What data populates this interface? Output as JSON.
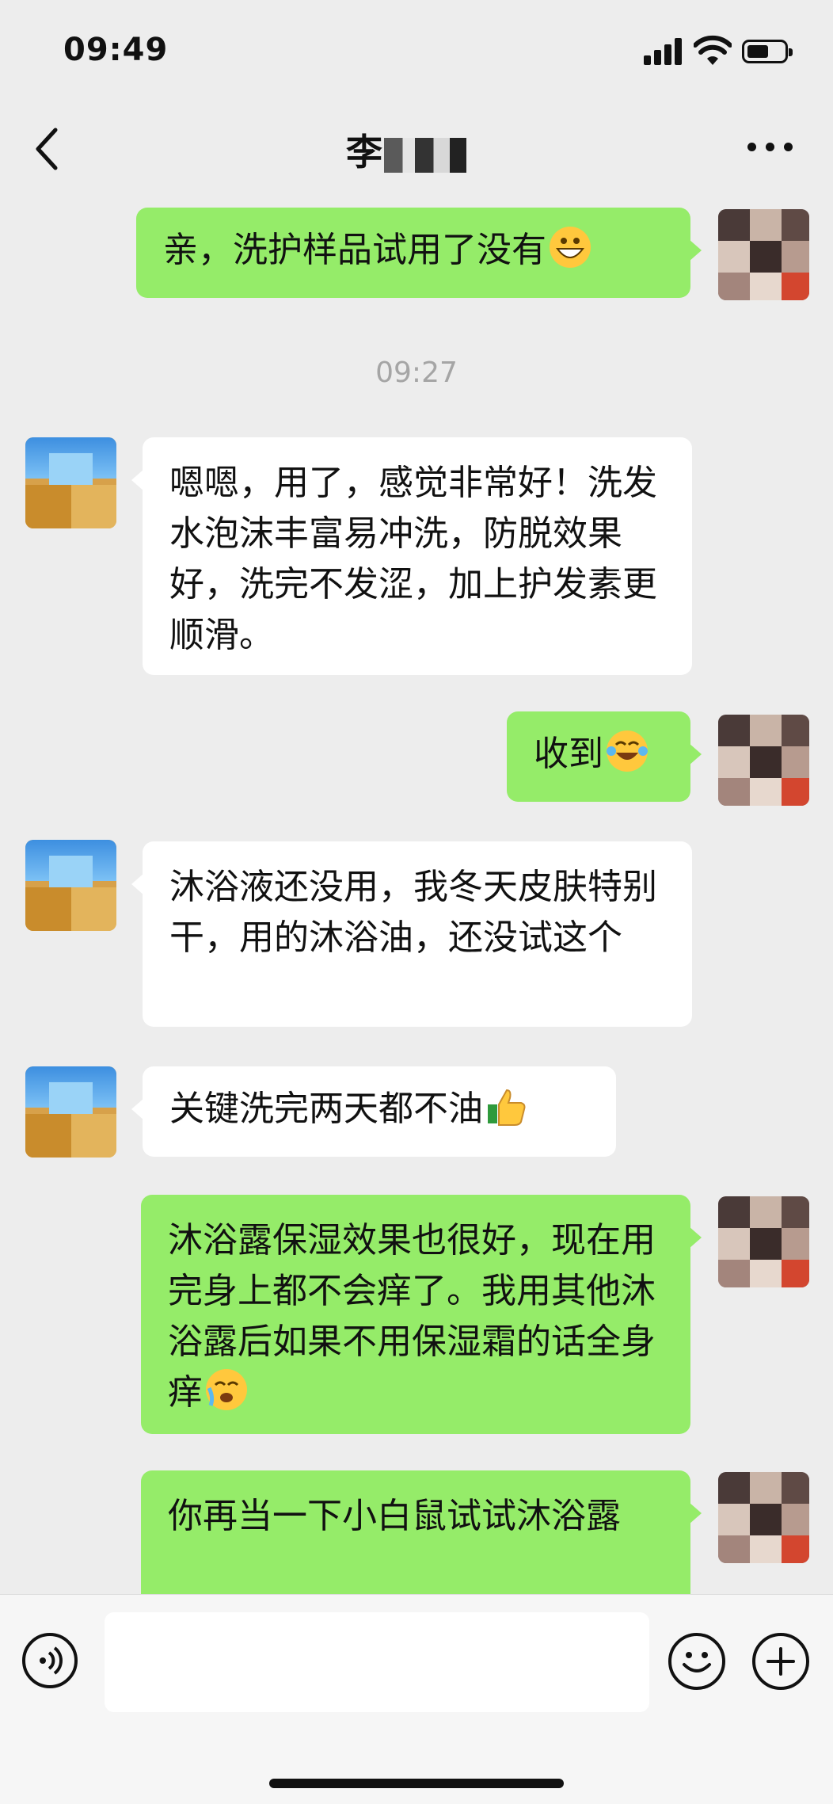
{
  "status_bar": {
    "time": "09:49"
  },
  "nav": {
    "title": "李",
    "back_icon": "chevron-left-icon",
    "more_icon": "more-dots-icon"
  },
  "messages": [
    {
      "side": "me",
      "text": "亲，洗护样品试用了没有",
      "emoji": "grinning-face-icon"
    },
    {
      "timestamp": "09:27"
    },
    {
      "side": "them",
      "text": "嗯嗯，用了，感觉非常好！洗发水泡沫丰富易冲洗，防脱效果好，洗完不发涩，加上护发素更顺滑。"
    },
    {
      "side": "me",
      "text": "收到",
      "emoji": "tears-of-joy-icon"
    },
    {
      "side": "them",
      "text": "沐浴液还没用，我冬天皮肤特别干，用的沐浴油，还没试这个"
    },
    {
      "side": "them",
      "text": "关键洗完两天都不油",
      "emoji": "thumbs-up-icon"
    },
    {
      "side": "me",
      "text": "沐浴露保湿效果也很好，现在用完身上都不会痒了。我用其他沐浴露后如果不用保湿霜的话全身痒",
      "emoji": "crying-face-icon"
    },
    {
      "side": "me",
      "text": "你再当一下小白鼠试试沐浴露"
    }
  ],
  "input_bar": {
    "placeholder": "",
    "voice_icon": "voice-icon",
    "emoji_icon": "emoji-icon",
    "plus_icon": "plus-icon"
  },
  "colors": {
    "me_bubble": "#95ec69",
    "them_bubble": "#ffffff",
    "background": "#ededed"
  }
}
